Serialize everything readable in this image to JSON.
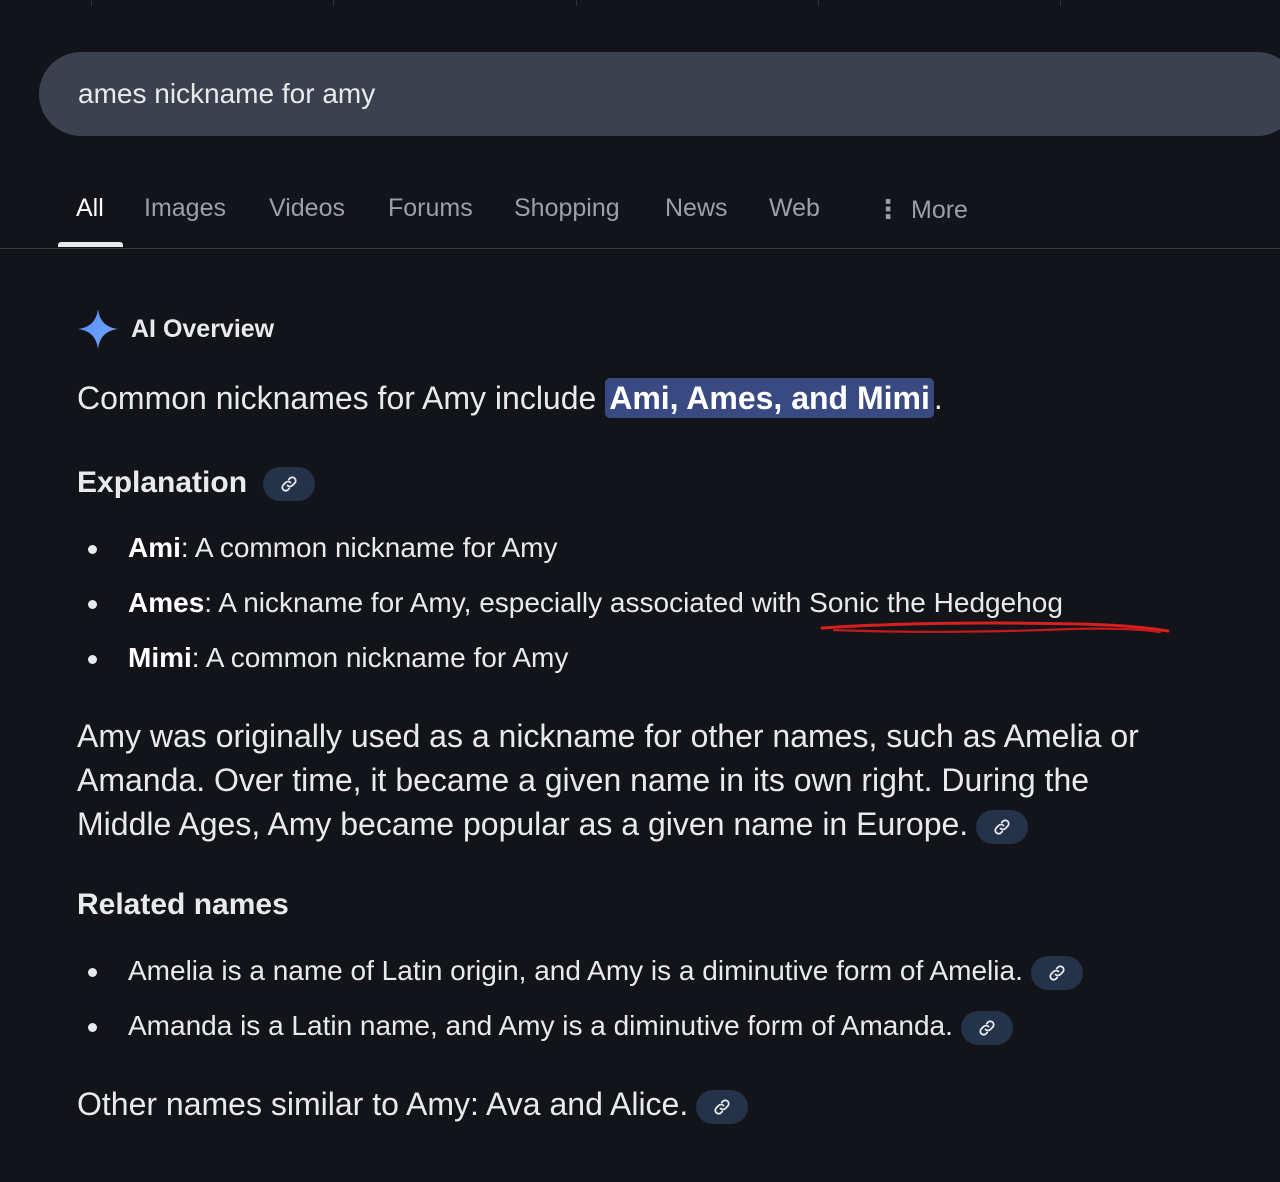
{
  "search": {
    "query": "ames nickname for amy"
  },
  "tabs": [
    {
      "label": "All"
    },
    {
      "label": "Images"
    },
    {
      "label": "Videos"
    },
    {
      "label": "Forums"
    },
    {
      "label": "Shopping"
    },
    {
      "label": "News"
    },
    {
      "label": "Web"
    },
    {
      "label": "More"
    }
  ],
  "ai_overview": {
    "title": "AI Overview",
    "summary_prefix": "Common nicknames for Amy include ",
    "summary_highlight": "Ami, Ames, and Mimi",
    "summary_suffix": ".",
    "explanation_heading": "Explanation",
    "explanation_items": [
      {
        "name": "Ami",
        "text": ": A common nickname for Amy"
      },
      {
        "name": "Ames",
        "text": ": A nickname for Amy, especially associated with Sonic the Hedgehog"
      },
      {
        "name": "Mimi",
        "text": ": A common nickname for Amy"
      }
    ],
    "history_lines": [
      "Amy was originally used as a nickname for other names, such as Amelia or",
      "Amanda. Over time, it became a given name in its own right. During the",
      "Middle Ages, Amy became popular as a given name in Europe."
    ],
    "related_heading": "Related names",
    "related_items": [
      "Amelia is a name of Latin origin, and Amy is a diminutive form of Amelia.",
      "Amanda is a Latin name, and Amy is a diminutive form of Amanda."
    ],
    "other_names": "Other names similar to Amy: Ava and Alice."
  },
  "colors": {
    "background": "#13141a",
    "search_bar": "#3c4150",
    "highlight": "#394a82",
    "link_chip": "#24324a",
    "annotation_red": "#d61f1f"
  },
  "icons": [
    "sparkle-icon",
    "link-icon",
    "more-vert-icon"
  ]
}
